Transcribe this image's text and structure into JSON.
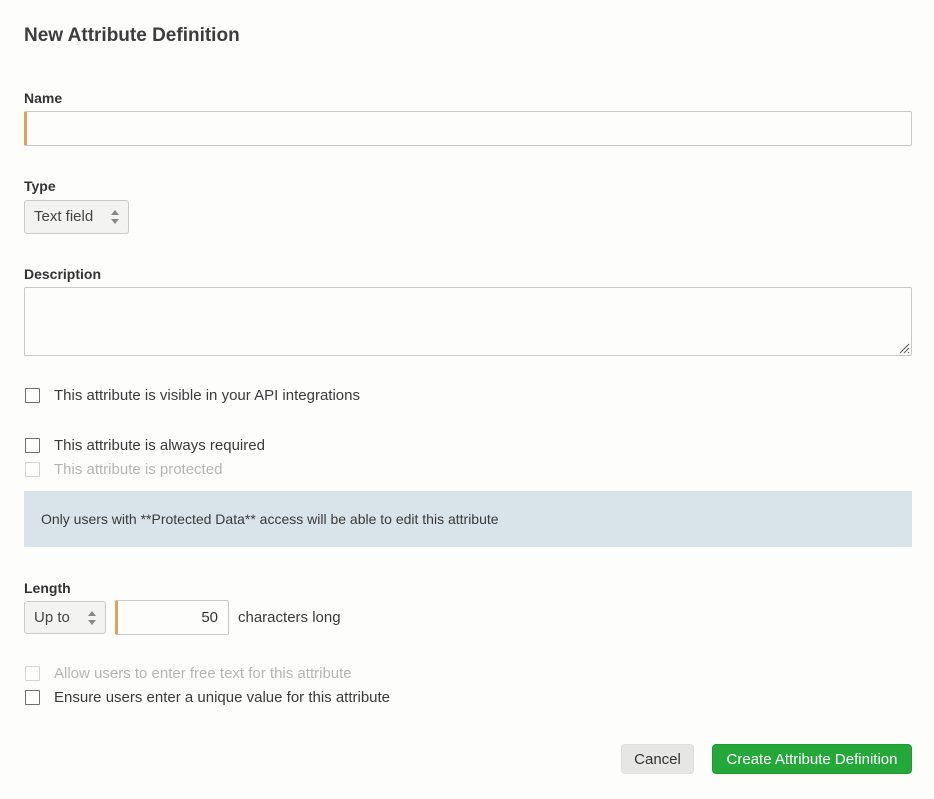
{
  "dialog": {
    "title": "New Attribute Definition"
  },
  "name_field": {
    "label": "Name",
    "value": ""
  },
  "type_field": {
    "label": "Type",
    "selected": "Text field"
  },
  "description_field": {
    "label": "Description",
    "value": ""
  },
  "options": {
    "api_visible": {
      "label": "This attribute is visible in your API integrations",
      "checked": false
    },
    "always_required": {
      "label": "This attribute is always required",
      "checked": false
    },
    "protected": {
      "label": "This attribute is protected",
      "checked": false,
      "disabled": true
    }
  },
  "notice": {
    "text": "Only users with **Protected Data** access will be able to edit this attribute"
  },
  "length": {
    "label": "Length",
    "mode_selected": "Up to",
    "value": "50",
    "suffix": "characters long"
  },
  "extra_options": {
    "free_text": {
      "label": "Allow users to enter free text for this attribute",
      "checked": false,
      "disabled": true
    },
    "unique_value": {
      "label": "Ensure users enter a unique value for this attribute",
      "checked": false
    }
  },
  "actions": {
    "cancel_label": "Cancel",
    "create_label": "Create Attribute Definition"
  },
  "colors": {
    "accent_required": "#d9a45c",
    "primary_button": "#25a83a",
    "notice_background": "#d9e4ea"
  }
}
